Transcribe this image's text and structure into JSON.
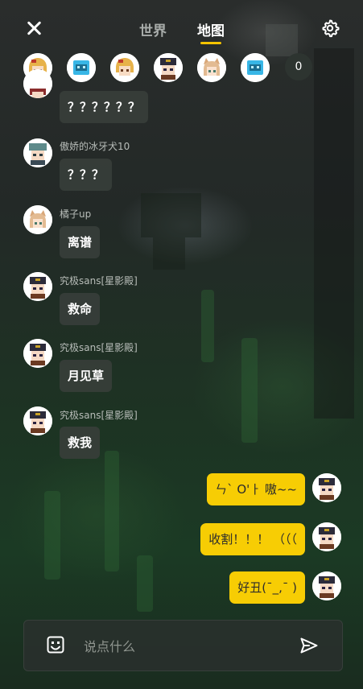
{
  "header": {
    "close_icon": "close-icon",
    "tabs": [
      {
        "label": "世界",
        "active": false
      },
      {
        "label": "地图",
        "active": true
      }
    ],
    "settings_icon": "gear-icon",
    "active_color": "#f5c400"
  },
  "players": {
    "avatars": [
      "blonde-girl",
      "blue-robot",
      "blonde-girl",
      "dark-hat-boy",
      "fox-girl",
      "blue-robot"
    ],
    "count": "0"
  },
  "messages": [
    {
      "side": "in",
      "name": "",
      "text": "？？？？？？",
      "avatar": "red-hair"
    },
    {
      "side": "in",
      "name": "傲娇的冰牙犬10",
      "text": "？？？",
      "avatar": "teal-hat-boy"
    },
    {
      "side": "in",
      "name": "橘子up",
      "text": "离谱",
      "avatar": "fox-girl"
    },
    {
      "side": "in",
      "name": "究极sans[星影殿]",
      "text": "救命",
      "avatar": "dark-hat-boy"
    },
    {
      "side": "in",
      "name": "究极sans[星影殿]",
      "text": "月见草",
      "avatar": "dark-hat-boy"
    },
    {
      "side": "in",
      "name": "究极sans[星影殿]",
      "text": "救我",
      "avatar": "dark-hat-boy"
    },
    {
      "side": "out",
      "text": "ㄣ` O'ㅏ   嗷~~",
      "avatar": "dark-hat-boy"
    },
    {
      "side": "out",
      "text": "收割！！！  （（（",
      "avatar": "dark-hat-boy"
    },
    {
      "side": "out",
      "text": "好丑(ˉ_,ˉ )",
      "avatar": "dark-hat-boy"
    }
  ],
  "input": {
    "placeholder": "说点什么",
    "emoji_icon": "emoji-icon",
    "send_icon": "send-icon"
  },
  "colors": {
    "bubble_out": "#f7cd04",
    "bubble_in": "#373e3a"
  }
}
